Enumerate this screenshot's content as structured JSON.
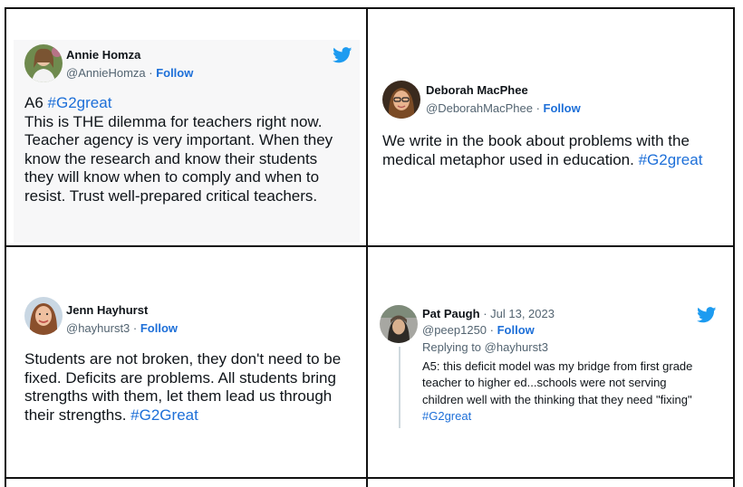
{
  "tweets": [
    {
      "name": "Annie Homza",
      "handle": "@AnnieHomza",
      "follow": "Follow",
      "lines": [
        [
          "A6 ",
          "#G2great"
        ],
        [
          "This is THE dilemma for teachers right now.",
          ""
        ],
        [
          "Teacher agency is very important. When they",
          ""
        ],
        [
          "know the research and know their students",
          ""
        ],
        [
          "they will know when to comply and when to",
          ""
        ],
        [
          "resist. Trust well-prepared critical teachers.",
          ""
        ]
      ]
    },
    {
      "name": "Deborah MacPhee",
      "handle": "@DeborahMacPhee",
      "follow": "Follow",
      "lines": [
        [
          "We write in the book about problems with the",
          ""
        ],
        [
          "medical metaphor used in education. ",
          "#G2great"
        ]
      ]
    },
    {
      "name": "Jenn Hayhurst",
      "handle": "@hayhurst3",
      "follow": "Follow",
      "lines": [
        [
          "Students are not broken, they don't need to be",
          ""
        ],
        [
          "fixed. Deficits are problems. All students bring",
          ""
        ],
        [
          "strengths with them, let them lead us through",
          ""
        ],
        [
          "their strengths. ",
          "#G2Great"
        ]
      ]
    },
    {
      "name": "Pat Paugh",
      "date": "Jul 13, 2023",
      "handle": "@peep1250",
      "follow": "Follow",
      "reply": "Replying to @hayhurst3",
      "lines": [
        [
          "A5: this deficit model was my bridge from first grade",
          ""
        ],
        [
          "teacher to higher ed...schools were not serving",
          ""
        ],
        [
          "children well with the thinking that they need \"fixing\"",
          ""
        ],
        [
          "",
          "#G2great"
        ]
      ]
    }
  ],
  "separator": " · ",
  "colors": {
    "link": "#1d6fd8",
    "twitter_blue": "#1d9bf0",
    "grid": "#111111"
  },
  "icons": {
    "logo": "twitter-bird-icon"
  }
}
